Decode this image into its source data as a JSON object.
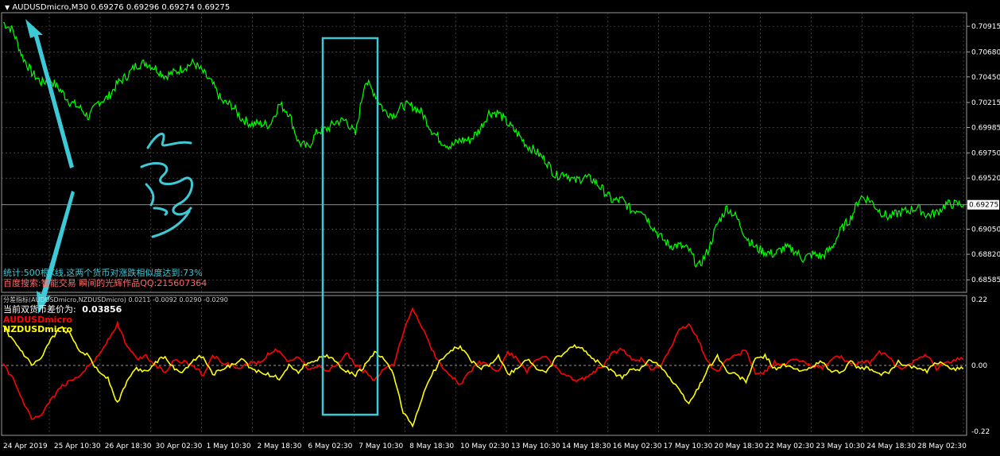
{
  "window": {
    "symbol_header": "AUDUSDmicro,M30  0.69276 0.69296 0.69274 0.69275",
    "indicator_header": "分差指标(AUDUSDmicro,NZDUSDmicro) 0.0211 -0.0092 0.0290 -0.0290",
    "stat_line": "统计:500根K线,这两个货币对涨跌相似度达到:73%",
    "ad_line": "百度搜索:智能交易 瞬间的光辉作品QQ:215607364",
    "diff_label": "当前双货币差价为:",
    "diff_value": "0.03856",
    "series_labels": [
      "AUDUSDmicro",
      "NZDUSDmicro"
    ],
    "current_price": "0.69275"
  },
  "colors": {
    "background": "#000000",
    "price_line": "#00ff00",
    "aud_line": "#ff0000",
    "nzd_line": "#ffff00",
    "annotation": "#3ec9d6",
    "stat_text": "#3ec9d6",
    "ad_text": "#ff6a6a"
  },
  "chart_data": [
    {
      "type": "line",
      "ylim": [
        0.6847,
        0.7104
      ],
      "grid": true,
      "y_ticks": [
        "0.70915",
        "0.70680",
        "0.70450",
        "0.70215",
        "0.69985",
        "0.69750",
        "0.69520",
        "0.69275",
        "0.69050",
        "0.68820",
        "0.68585"
      ],
      "y_tick_values": [
        0.70915,
        0.7068,
        0.7045,
        0.70215,
        0.69985,
        0.6975,
        0.6952,
        0.69275,
        0.6905,
        0.6882,
        0.68585
      ],
      "x_ticks": [
        "24 Apr 2019",
        "25 Apr 10:30",
        "26 Apr 18:30",
        "30 Apr 02:30",
        "1 May 10:30",
        "2 May 18:30",
        "6 May 02:30",
        "7 May 10:30",
        "8 May 18:30",
        "10 May 02:30",
        "13 May 10:30",
        "14 May 18:30",
        "16 May 02:30",
        "17 May 10:30",
        "20 May 18:30",
        "22 May 02:30",
        "23 May 10:30",
        "24 May 18:30",
        "28 May 02:30"
      ],
      "series": [
        {
          "name": "AUDUSDmicro",
          "values": [
            0.7095,
            0.7088,
            0.7064,
            0.7049,
            0.704,
            0.7042,
            0.7033,
            0.7022,
            0.7017,
            0.7008,
            0.7022,
            0.7026,
            0.7039,
            0.7046,
            0.7056,
            0.7058,
            0.7053,
            0.7046,
            0.7049,
            0.7054,
            0.7058,
            0.7049,
            0.7038,
            0.7022,
            0.7019,
            0.7007,
            0.7002,
            0.7002,
            0.7001,
            0.702,
            0.7012,
            0.6985,
            0.698,
            0.6995,
            0.6997,
            0.7004,
            0.7005,
            0.6992,
            0.7042,
            0.703,
            0.7014,
            0.701,
            0.7019,
            0.7018,
            0.7012,
            0.6996,
            0.6986,
            0.6981,
            0.6987,
            0.6987,
            0.6996,
            0.7012,
            0.7012,
            0.7002,
            0.6993,
            0.6982,
            0.6976,
            0.6968,
            0.6954,
            0.6957,
            0.6949,
            0.6953,
            0.695,
            0.6941,
            0.6931,
            0.6932,
            0.6922,
            0.6924,
            0.691,
            0.6898,
            0.689,
            0.689,
            0.6886,
            0.687,
            0.6885,
            0.691,
            0.6925,
            0.6916,
            0.6898,
            0.6888,
            0.6884,
            0.6882,
            0.6888,
            0.6886,
            0.6878,
            0.6882,
            0.688,
            0.6888,
            0.6905,
            0.6915,
            0.6935,
            0.6932,
            0.6922,
            0.6916,
            0.692,
            0.6922,
            0.6925,
            0.6918,
            0.692,
            0.6928,
            0.6928,
            0.6928
          ]
        },
        {
          "name": "AUDUSDmicro",
          "values": [
            0.0,
            -0.04,
            -0.11,
            -0.17,
            -0.16,
            -0.11,
            -0.07,
            -0.05,
            -0.03,
            0.0,
            0.03,
            0.08,
            0.13,
            0.06,
            0.02,
            0.03,
            0.0,
            -0.02,
            0.02,
            0.01,
            0.0,
            -0.03,
            0.03,
            0.01,
            0.0,
            -0.01,
            0.01,
            0.01,
            0.04,
            0.05,
            0.01,
            0.03,
            -0.01,
            0.0,
            -0.02,
            0.0,
            0.04,
            0.0,
            -0.02,
            -0.05,
            -0.01,
            0.0,
            0.1,
            0.18,
            0.12,
            0.05,
            0.0,
            -0.03,
            -0.06,
            -0.02,
            0.01,
            0.0,
            -0.02,
            0.04,
            0.02,
            -0.02,
            0.02,
            0.03,
            -0.01,
            -0.03,
            -0.05,
            -0.04,
            -0.02,
            0.0,
            0.04,
            0.05,
            0.02,
            0.02,
            -0.01,
            0.0,
            0.05,
            0.11,
            0.13,
            0.08,
            0.01,
            -0.02,
            0.02,
            0.03,
            0.05,
            -0.03,
            -0.02,
            0.01,
            0.0,
            0.02,
            0.01,
            0.0,
            -0.01,
            0.02,
            0.03,
            0.0,
            0.01,
            0.01,
            0.04,
            0.03,
            -0.01,
            0.0,
            0.02,
            0.03,
            -0.01,
            0.01,
            0.02,
            0.02
          ]
        },
        {
          "name": "NZDUSDmicro",
          "values": [
            0.12,
            0.08,
            0.04,
            0.0,
            0.02,
            0.08,
            0.12,
            0.1,
            0.05,
            0.03,
            -0.02,
            -0.04,
            -0.12,
            -0.05,
            -0.01,
            -0.02,
            0.01,
            0.03,
            -0.01,
            -0.02,
            0.02,
            0.03,
            -0.03,
            -0.01,
            0.0,
            0.02,
            -0.01,
            -0.02,
            -0.03,
            -0.04,
            0.0,
            -0.02,
            0.01,
            0.02,
            0.03,
            0.01,
            -0.02,
            -0.03,
            0.0,
            0.04,
            0.02,
            -0.03,
            -0.15,
            -0.19,
            -0.1,
            -0.03,
            0.02,
            0.05,
            0.06,
            0.02,
            -0.01,
            0.0,
            0.03,
            -0.03,
            -0.01,
            0.02,
            -0.01,
            -0.02,
            0.02,
            0.04,
            0.06,
            0.05,
            0.02,
            0.0,
            -0.02,
            -0.04,
            -0.01,
            -0.01,
            0.02,
            0.0,
            -0.04,
            -0.08,
            -0.12,
            -0.07,
            -0.01,
            0.03,
            -0.02,
            -0.03,
            -0.05,
            0.02,
            0.03,
            -0.01,
            0.0,
            -0.01,
            -0.02,
            0.0,
            0.01,
            -0.02,
            -0.02,
            0.01,
            -0.01,
            -0.01,
            -0.03,
            -0.02,
            0.01,
            0.0,
            -0.01,
            -0.02,
            0.01,
            0.0,
            -0.01,
            -0.01
          ]
        }
      ],
      "sub_ylim": [
        -0.22,
        0.22
      ],
      "sub_y_ticks": [
        "0.22",
        "0.00",
        "-0.22"
      ],
      "sub_y_tick_values": [
        0.22,
        0.0,
        -0.22
      ]
    }
  ]
}
